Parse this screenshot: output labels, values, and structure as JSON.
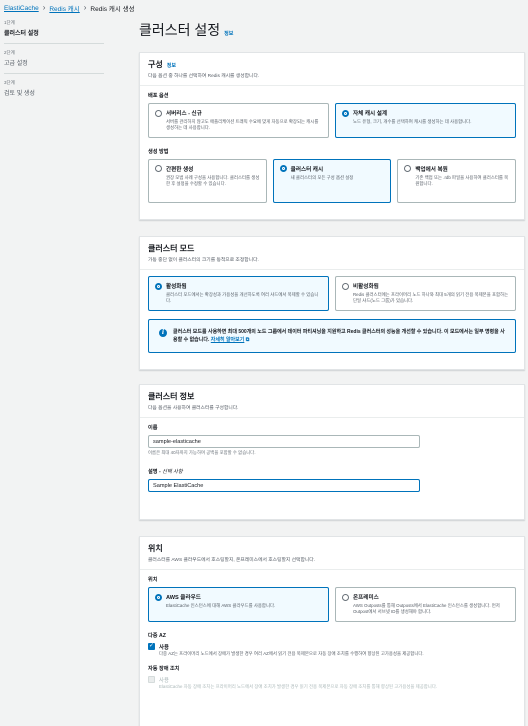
{
  "breadcrumb": {
    "items": [
      "ElastiCache",
      "Redis 캐시",
      "Redis 캐시 생성"
    ]
  },
  "steps": [
    {
      "num": "1단계",
      "label": "클러스터 설정"
    },
    {
      "num": "2단계",
      "label": "고급 설정"
    },
    {
      "num": "3단계",
      "label": "검토 및 생성"
    }
  ],
  "page": {
    "title": "클러스터 설정",
    "info": "정보"
  },
  "config": {
    "title": "구성",
    "info": "정보",
    "desc": "다음 옵션 중 하나를 선택하여 Redis 캐시를 생성합니다.",
    "deploy_label": "배포 옵션",
    "deploy": [
      {
        "title": "서버리스 - 신규",
        "desc": "서버를 관리하지 않고도 애플리케이션 트래픽 수요에 맞게 자동으로 확장되는 캐시를 생성하는 데 사용합니다."
      },
      {
        "title": "자체 캐시 설계",
        "desc": "노드 유형, 크기, 개수를 선택하여 캐시를 생성하는 데 사용합니다."
      }
    ],
    "create_label": "생성 방법",
    "create": [
      {
        "title": "간편한 생성",
        "desc": "권장 모범 사례 구성을 사용합니다. 클러스터를 생성한 후 설정을 수정할 수 있습니다."
      },
      {
        "title": "클러스터 캐시",
        "desc": "새 클러스터의 모든 구성 옵션 설정"
      },
      {
        "title": "백업에서 복원",
        "desc": "기존 백업 또는 .rdb 파일을 사용하여 클러스터를 복원합니다."
      }
    ]
  },
  "mode": {
    "title": "클러스터 모드",
    "desc": "가동 중단 없이 클러스터의 크기를 동적으로 조정합니다.",
    "options": [
      {
        "title": "활성화됨",
        "desc": "클러스터 모드에서는 확장성과 가용성을 개선하도록 여러 샤드에서 복제할 수 있습니다."
      },
      {
        "title": "비활성화됨",
        "desc": "Redis 클러스터에는 프라이머리 노드 하나와 최대 5개의 읽기 전용 복제본을 포함하는 단일 샤드(노드 그룹)가 있습니다."
      }
    ],
    "alert_text": "클러스터 모드를 사용하면 최대 500개의 노드 그룹에서 데이터 파티셔닝을 지원하고 Redis 클러스터의 성능을 개선할 수 있습니다. 이 모드에서는 일부 명령을 사용할 수 없습니다.",
    "alert_link": "자세히 알아보기"
  },
  "info": {
    "title": "클러스터 정보",
    "desc": "다음 옵션을 사용하여 클러스터를 구성합니다.",
    "name_label": "이름",
    "name_value": "sample-elasticache",
    "name_hint": "이름은 최대 40자까지 가능하며 공백을 포함할 수 없습니다.",
    "desc_label": "설명",
    "desc_optional": "선택 사항",
    "desc_value": "Sample ElastiCache"
  },
  "location": {
    "title": "위치",
    "desc": "클러스터를 AWS 클라우드에서 호스팅할지, 온프레미스에서 호스팅할지 선택합니다.",
    "label": "위치",
    "options": [
      {
        "title": "AWS 클라우드",
        "desc": "ElastiCache 인스턴스에 대해 AWS 클라우드를 사용합니다."
      },
      {
        "title": "온프레미스",
        "desc": "AWS Outposts를 통해 Outposts에서 ElastiCache 인스턴스를 생성합니다. 먼저 Outpost에서 서브넷 ID를 생성해야 합니다."
      }
    ],
    "multiaz_label": "다중 AZ",
    "multiaz_check": "사용",
    "multiaz_desc": "다중 AZ는 프라이머리 노드에서 장애가 발생한 경우 여러 AZ에서 읽기 전용 복제본으로 자동 장애 조치를 수행하여 향상된 고가용성을 제공합니다.",
    "failover_label": "자동 장애 조치",
    "failover_check": "사용",
    "failover_desc": "ElastiCache 자동 장애 조치는 프라이머리 노드에서 장애 조치가 발생한 경우 읽기 전용 복제본으로 자동 장애 조치를 통해 향상된 고가용성을 제공합니다."
  }
}
